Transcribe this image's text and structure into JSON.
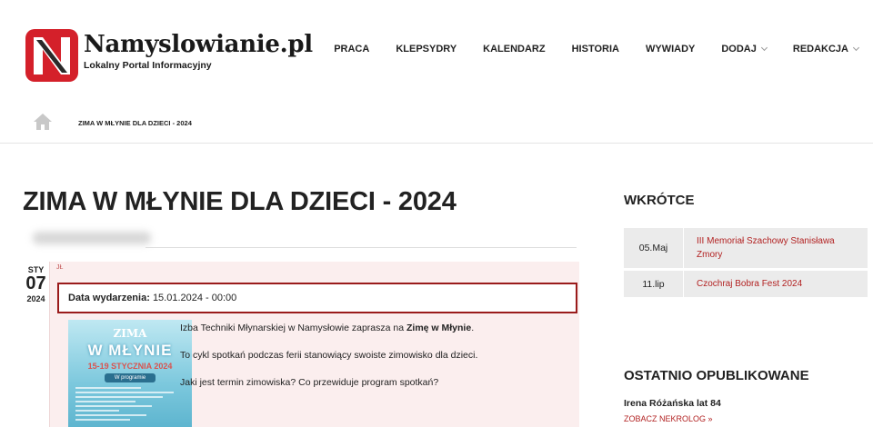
{
  "brand": {
    "name": "Namyslowianie.pl",
    "tagline": "Lokalny Portal Informacyjny",
    "accent": "#d4202a"
  },
  "nav": {
    "items": [
      {
        "label": "PRACA"
      },
      {
        "label": "KLEPSYDRY"
      },
      {
        "label": "KALENDARZ"
      },
      {
        "label": "HISTORIA"
      },
      {
        "label": "WYWIADY"
      },
      {
        "label": "DODAJ"
      },
      {
        "label": "REDAKCJA"
      }
    ]
  },
  "breadcrumb": {
    "home_icon": "home-icon",
    "current": "ZIMA W MŁYNIE DLA DZIECI - 2024"
  },
  "article": {
    "title": "ZIMA W MŁYNIE DLA DZIECI - 2024",
    "date": {
      "month": "STY",
      "day": "07",
      "year": "2024"
    },
    "author_initials": "JŁ",
    "event_date_label": "Data wydarzenia:",
    "event_date_value": "15.01.2024 - 00:00",
    "poster": {
      "line1": "ZIMA",
      "line2": "W MŁYNIE",
      "dates": "15-19 STYCZNIA 2024",
      "program": "W programie"
    },
    "paragraph1_prefix": "Izba Techniki Młynarskiej w Namysłowie zaprasza na ",
    "paragraph1_bold": "Zimę w Młynie",
    "paragraph1_suffix": ".",
    "paragraph2": "To cykl spotkań podczas ferii stanowiący swoiste zimowisko dla dzieci.",
    "paragraph3": "Jaki jest termin zimowiska? Co przewiduje program spotkań?"
  },
  "sidebar": {
    "upcoming_heading": "WKRÓTCE",
    "upcoming": [
      {
        "date": "05.Maj",
        "title": "III Memoriał Szachowy Stanisława Zmory"
      },
      {
        "date": "11.lip",
        "title": "Czochraj Bobra Fest 2024"
      }
    ],
    "recent_heading": "OSTATNIO OPUBLIKOWANE",
    "recent_name": "Irena Różańska lat 84",
    "recent_link": "ZOBACZ NEKROLOG »"
  }
}
